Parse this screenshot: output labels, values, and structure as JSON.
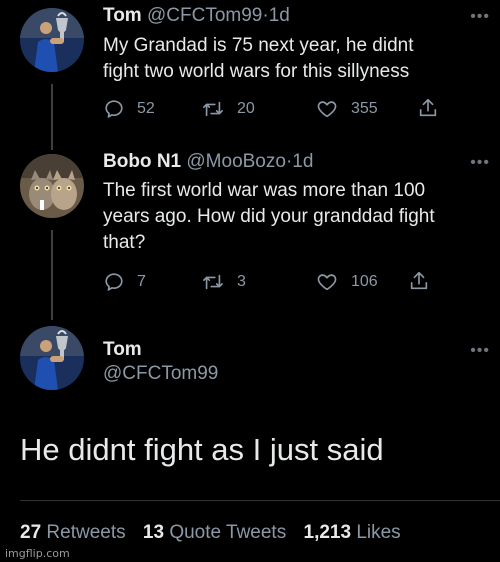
{
  "tweets": [
    {
      "name": "Tom",
      "handle": "@CFCTom99",
      "sep": "·",
      "time": "1d",
      "text_lines": [
        "My Grandad is 75 next year,  he didnt",
        "fight two world wars for this sillyness"
      ],
      "replies": "52",
      "retweets": "20",
      "likes": "355",
      "avatar": "chelsea-trophy-avatar"
    },
    {
      "name": "Bobo N1",
      "handle": "@MooBozo",
      "sep": "·",
      "time": "1d",
      "text_lines": [
        "The first world war was more than 100",
        "years ago. How did your granddad fight",
        "that?"
      ],
      "replies": "7",
      "retweets": "3",
      "likes": "106",
      "avatar": "two-cats-avatar"
    }
  ],
  "main_tweet": {
    "name": "Tom",
    "handle": "@CFCTom99",
    "text": "He didnt fight as I just said",
    "avatar": "chelsea-trophy-avatar"
  },
  "stats": {
    "retweets_count": "27",
    "retweets_label": "Retweets",
    "quote_count": "13",
    "quote_label": "Quote Tweets",
    "likes_count": "1,213",
    "likes_label": "Likes"
  },
  "icons": {
    "reply": "reply-icon",
    "retweet": "retweet-icon",
    "like": "heart-icon",
    "share": "share-icon",
    "more": "more-icon"
  },
  "colors": {
    "background": "#000000",
    "primary_text": "#e7e9ea",
    "secondary_text": "#8b98a5",
    "thread_line": "#3a3f44"
  },
  "watermark": "imgflip.com"
}
